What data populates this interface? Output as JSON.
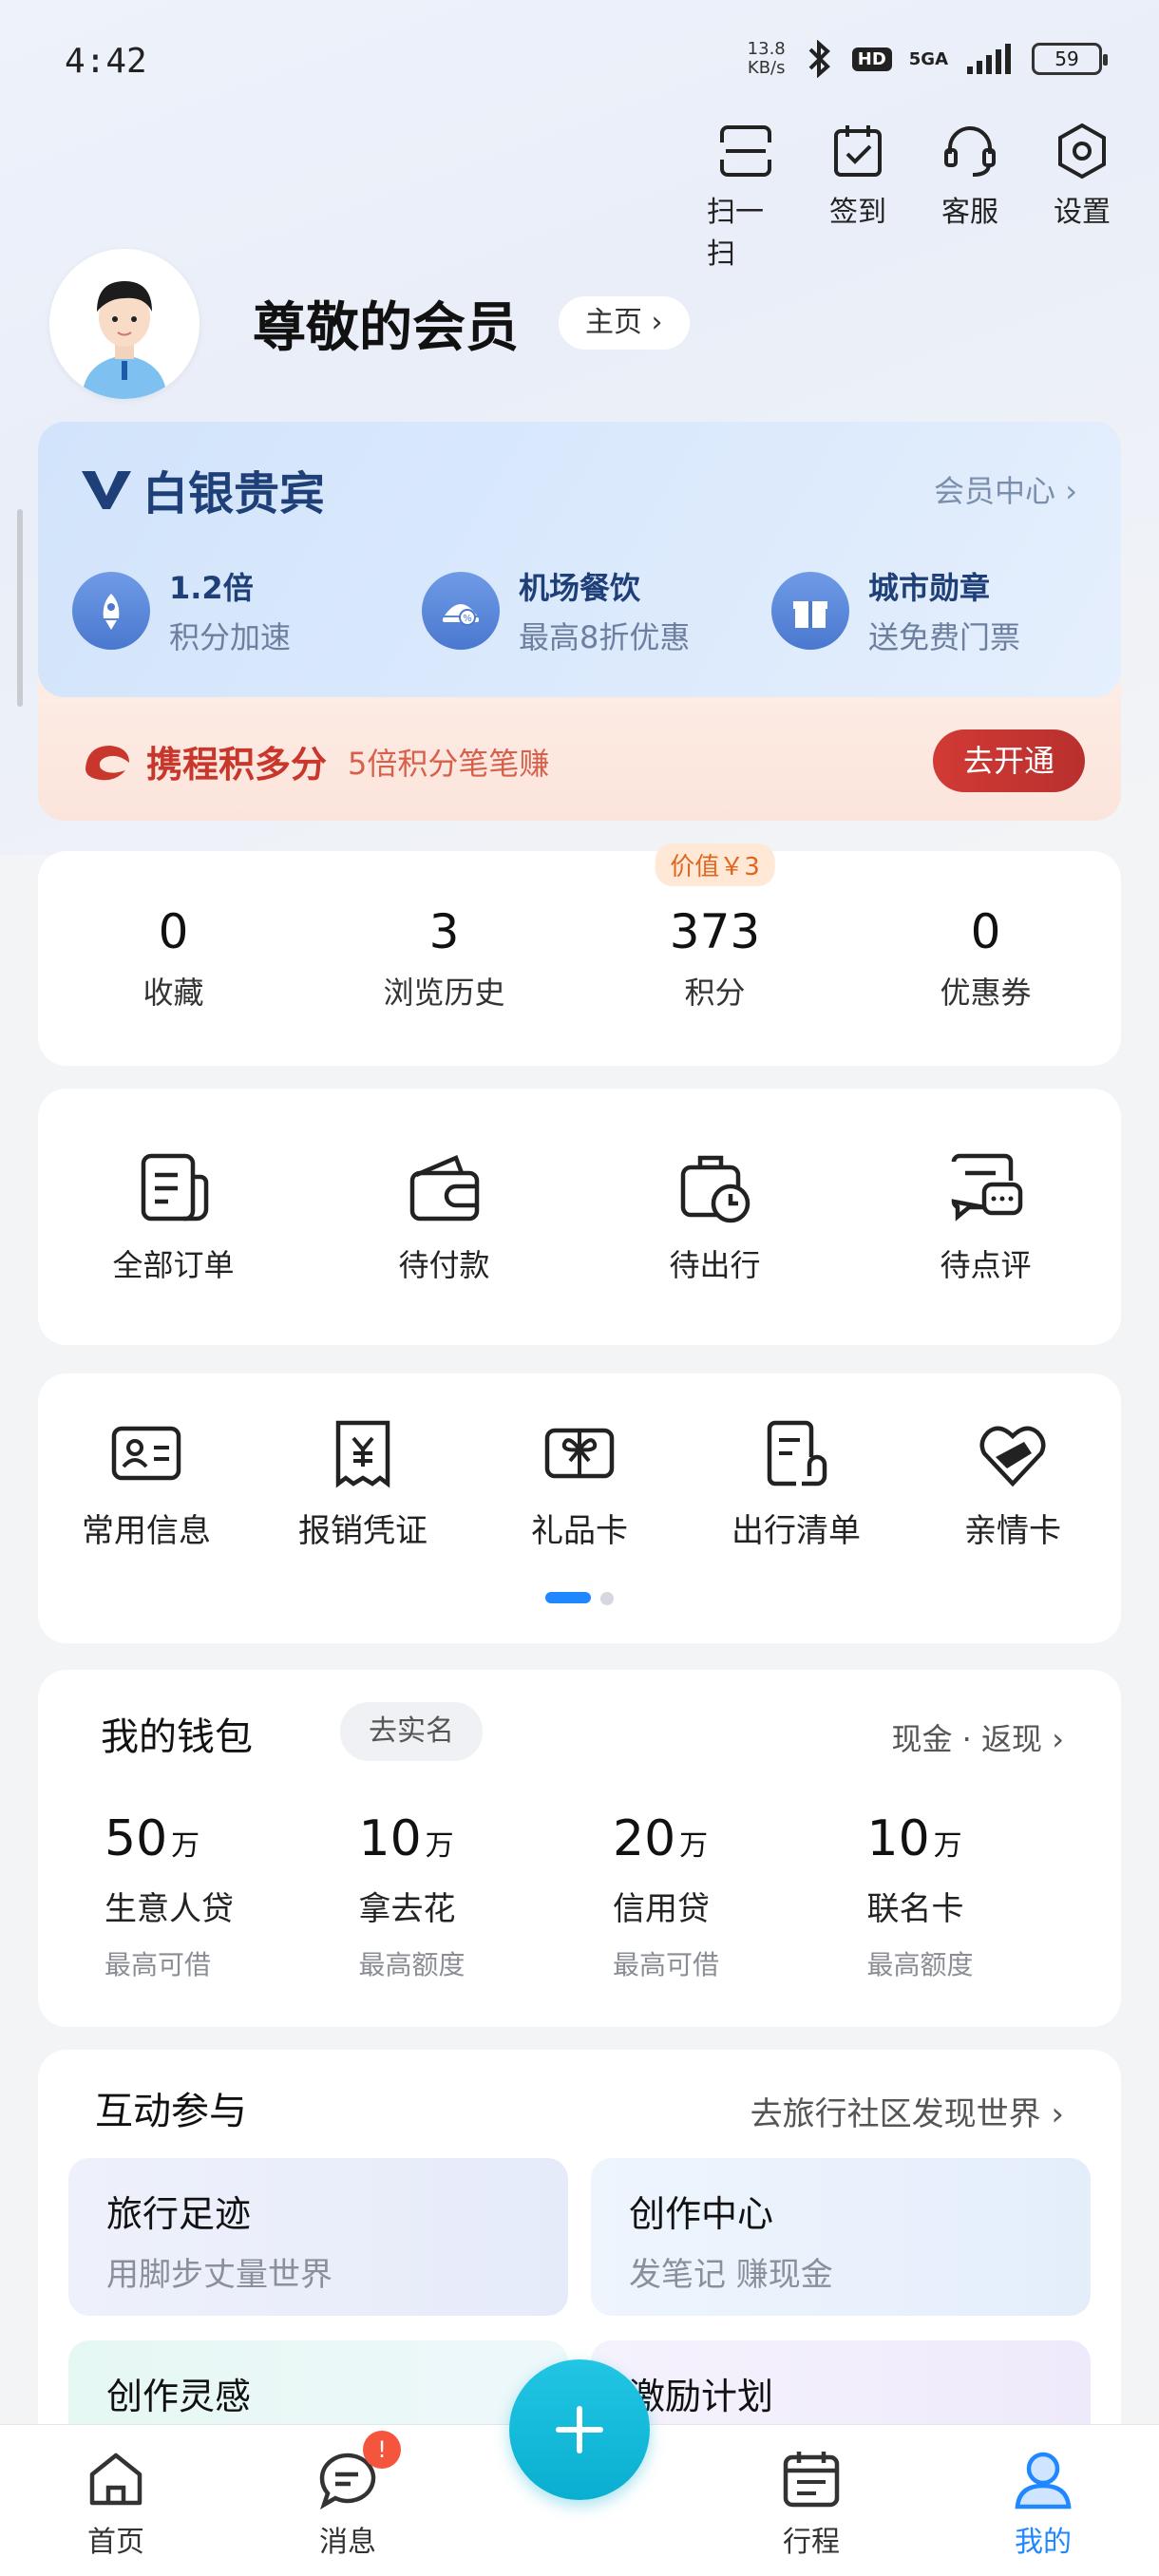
{
  "status_bar": {
    "time": "4:42",
    "net_speed_value": "13.8",
    "net_speed_unit": "KB/s",
    "hd": "HD",
    "signal": "5GA",
    "battery": "59"
  },
  "top_actions": [
    {
      "label": "扫一扫",
      "icon": "scan-icon"
    },
    {
      "label": "签到",
      "icon": "checkin-icon"
    },
    {
      "label": "客服",
      "icon": "customer-service-icon"
    },
    {
      "label": "设置",
      "icon": "settings-icon"
    }
  ],
  "profile": {
    "name": "尊敬的会员",
    "home_label": "主页",
    "home_chevron": "›"
  },
  "membership": {
    "tier_mark": "V",
    "tier": "白银贵宾",
    "center_link": "会员中心",
    "center_chevron": "›",
    "perks": [
      {
        "title": "1.2倍",
        "sub": "积分加速",
        "icon": "rocket-icon"
      },
      {
        "title": "机场餐饮",
        "sub": "最高8折优惠",
        "icon": "dining-icon"
      },
      {
        "title": "城市勋章",
        "sub": "送免费门票",
        "icon": "gift-icon"
      }
    ],
    "ctrip_brand": "携程积多分",
    "ctrip_slogan": "5倍积分笔笔赚",
    "open_button": "去开通"
  },
  "stats": [
    {
      "value": "0",
      "label": "收藏"
    },
    {
      "value": "3",
      "label": "浏览历史"
    },
    {
      "value": "373",
      "label": "积分",
      "badge": "价值￥3"
    },
    {
      "value": "0",
      "label": "优惠券"
    }
  ],
  "orders": [
    {
      "label": "全部订单",
      "icon": "orders-icon"
    },
    {
      "label": "待付款",
      "icon": "wallet-icon"
    },
    {
      "label": "待出行",
      "icon": "luggage-clock-icon"
    },
    {
      "label": "待点评",
      "icon": "review-icon"
    }
  ],
  "tools": [
    {
      "label": "常用信息",
      "icon": "id-card-icon"
    },
    {
      "label": "报销凭证",
      "icon": "receipt-icon"
    },
    {
      "label": "礼品卡",
      "icon": "gift-card-icon"
    },
    {
      "label": "出行清单",
      "icon": "checklist-icon"
    },
    {
      "label": "亲情卡",
      "icon": "family-card-icon"
    }
  ],
  "wallet": {
    "title": "我的钱包",
    "tag": "去实名",
    "link": "现金 · 返现",
    "link_chevron": "›",
    "items": [
      {
        "amount": "50",
        "unit": "万",
        "name": "生意人贷",
        "sub": "最高可借"
      },
      {
        "amount": "10",
        "unit": "万",
        "name": "拿去花",
        "sub": "最高额度"
      },
      {
        "amount": "20",
        "unit": "万",
        "name": "信用贷",
        "sub": "最高可借"
      },
      {
        "amount": "10",
        "unit": "万",
        "name": "联名卡",
        "sub": "最高额度"
      }
    ]
  },
  "interact": {
    "title": "互动参与",
    "link": "去旅行社区发现世界",
    "link_chevron": "›",
    "tiles": [
      {
        "title": "旅行足迹",
        "sub": "用脚步丈量世界"
      },
      {
        "title": "创作中心",
        "sub": "发笔记 赚现金"
      },
      {
        "title": "创作灵感",
        "sub": ""
      },
      {
        "title": "激励计划",
        "sub": ""
      }
    ]
  },
  "bottom_nav": [
    {
      "label": "首页",
      "icon": "home-icon"
    },
    {
      "label": "消息",
      "icon": "message-icon",
      "badge": "!"
    },
    {
      "label": "行程",
      "icon": "calendar-icon"
    },
    {
      "label": "我的",
      "icon": "profile-icon",
      "active": true
    }
  ],
  "colors": {
    "accent": "#1f87ff",
    "teal": "#0aaed0",
    "tier_text": "#1f3f78",
    "ctrip_red": "#c9372c"
  }
}
